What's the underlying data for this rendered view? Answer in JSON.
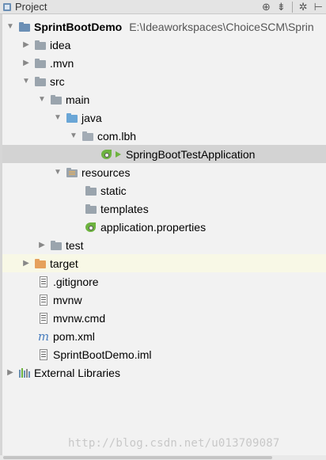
{
  "toolbar": {
    "title": "Project",
    "dropdown_glyph": "▾",
    "buttons": [
      {
        "icon": "target-icon",
        "glyph": "⊕"
      },
      {
        "icon": "collapse-all-icon",
        "glyph": "⇟"
      },
      {
        "icon": "gear-icon",
        "glyph": "✲"
      },
      {
        "icon": "hide-icon",
        "glyph": "⊢"
      }
    ]
  },
  "tree": {
    "root": {
      "label": "SprintBootDemo",
      "path": "E:\\Ideaworkspaces\\ChoiceSCM\\Sprin"
    },
    "idea": "idea",
    "mvn": ".mvn",
    "src": "src",
    "main": "main",
    "java": "java",
    "pkg": "com.lbh",
    "app_class": "SpringBootTestApplication",
    "resources": "resources",
    "static": "static",
    "templates": "templates",
    "app_props": "application.properties",
    "test": "test",
    "target": "target",
    "gitignore": ".gitignore",
    "mvnw": "mvnw",
    "mvnw_cmd": "mvnw.cmd",
    "pom": "pom.xml",
    "iml": "SprintBootDemo.iml",
    "ext_libs": "External Libraries"
  },
  "watermark": "http://blog.csdn.net/u013709087"
}
